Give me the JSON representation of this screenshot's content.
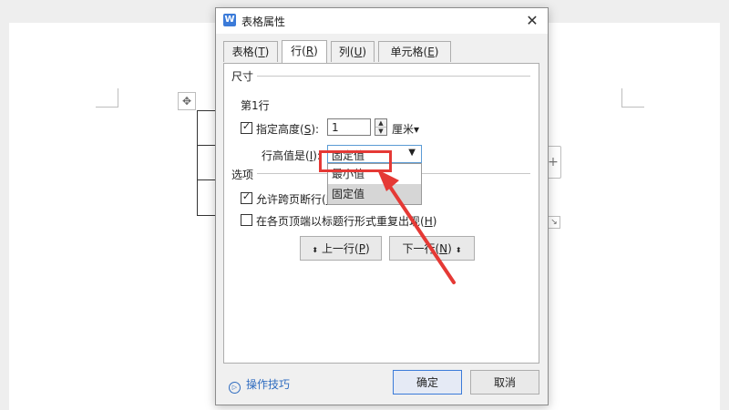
{
  "icons": {
    "app": "wps-writer-icon",
    "close": "close-icon",
    "table_move": "move-cross-icon",
    "add_col": "plus-icon",
    "resize": "resize-corner-icon",
    "help": "play-circle-icon"
  },
  "glyphs": {
    "app": "W",
    "close": "✕",
    "table_move": "✥",
    "add_col": "+",
    "resize": "↘",
    "help": "▷",
    "check": "✓",
    "spin_up": "▲",
    "spin_down": "▼",
    "select_arrow": "▼"
  },
  "colors": {
    "accent": "#3b7bd9",
    "annotation": "#e53935",
    "link": "#2f6cc0"
  },
  "dialog": {
    "title": "表格属性",
    "tabs": [
      {
        "label": "表格(",
        "key": "T",
        "suffix": ")"
      },
      {
        "label": "行(",
        "key": "R",
        "suffix": ")"
      },
      {
        "label": "列(",
        "key": "U",
        "suffix": ")"
      },
      {
        "label": "单元格(",
        "key": "E",
        "suffix": ")"
      }
    ],
    "active_tab": "行(R)",
    "size_section": {
      "label": "尺寸",
      "row_label": "第1行",
      "specify_height": {
        "label": "指定高度(",
        "key": "S",
        "suffix": "):",
        "checked": true
      },
      "height_value": "1",
      "unit": "厘米▾",
      "height_type": {
        "label": "行高值是(",
        "key": "I",
        "suffix": "):",
        "selected": "固定值"
      },
      "dropdown_options": [
        "最小值",
        "固定值"
      ]
    },
    "options_section": {
      "label": "选项",
      "allow_break": {
        "label": "允许跨页断行(",
        "key": "K",
        "suffix": ")",
        "checked": true
      },
      "repeat_header": {
        "label": "在各页顶端以标题行形式重复出现(",
        "key": "H",
        "suffix": ")",
        "checked": false
      }
    },
    "nav": {
      "prev": {
        "arrow": "⬍",
        "label": "上一行(",
        "key": "P",
        "suffix": ")"
      },
      "next": {
        "label": "下一行(",
        "key": "N",
        "suffix": ")",
        "arrow": "⬍"
      }
    },
    "help_link": "操作技巧",
    "ok_label": "确定",
    "cancel_label": "取消"
  }
}
